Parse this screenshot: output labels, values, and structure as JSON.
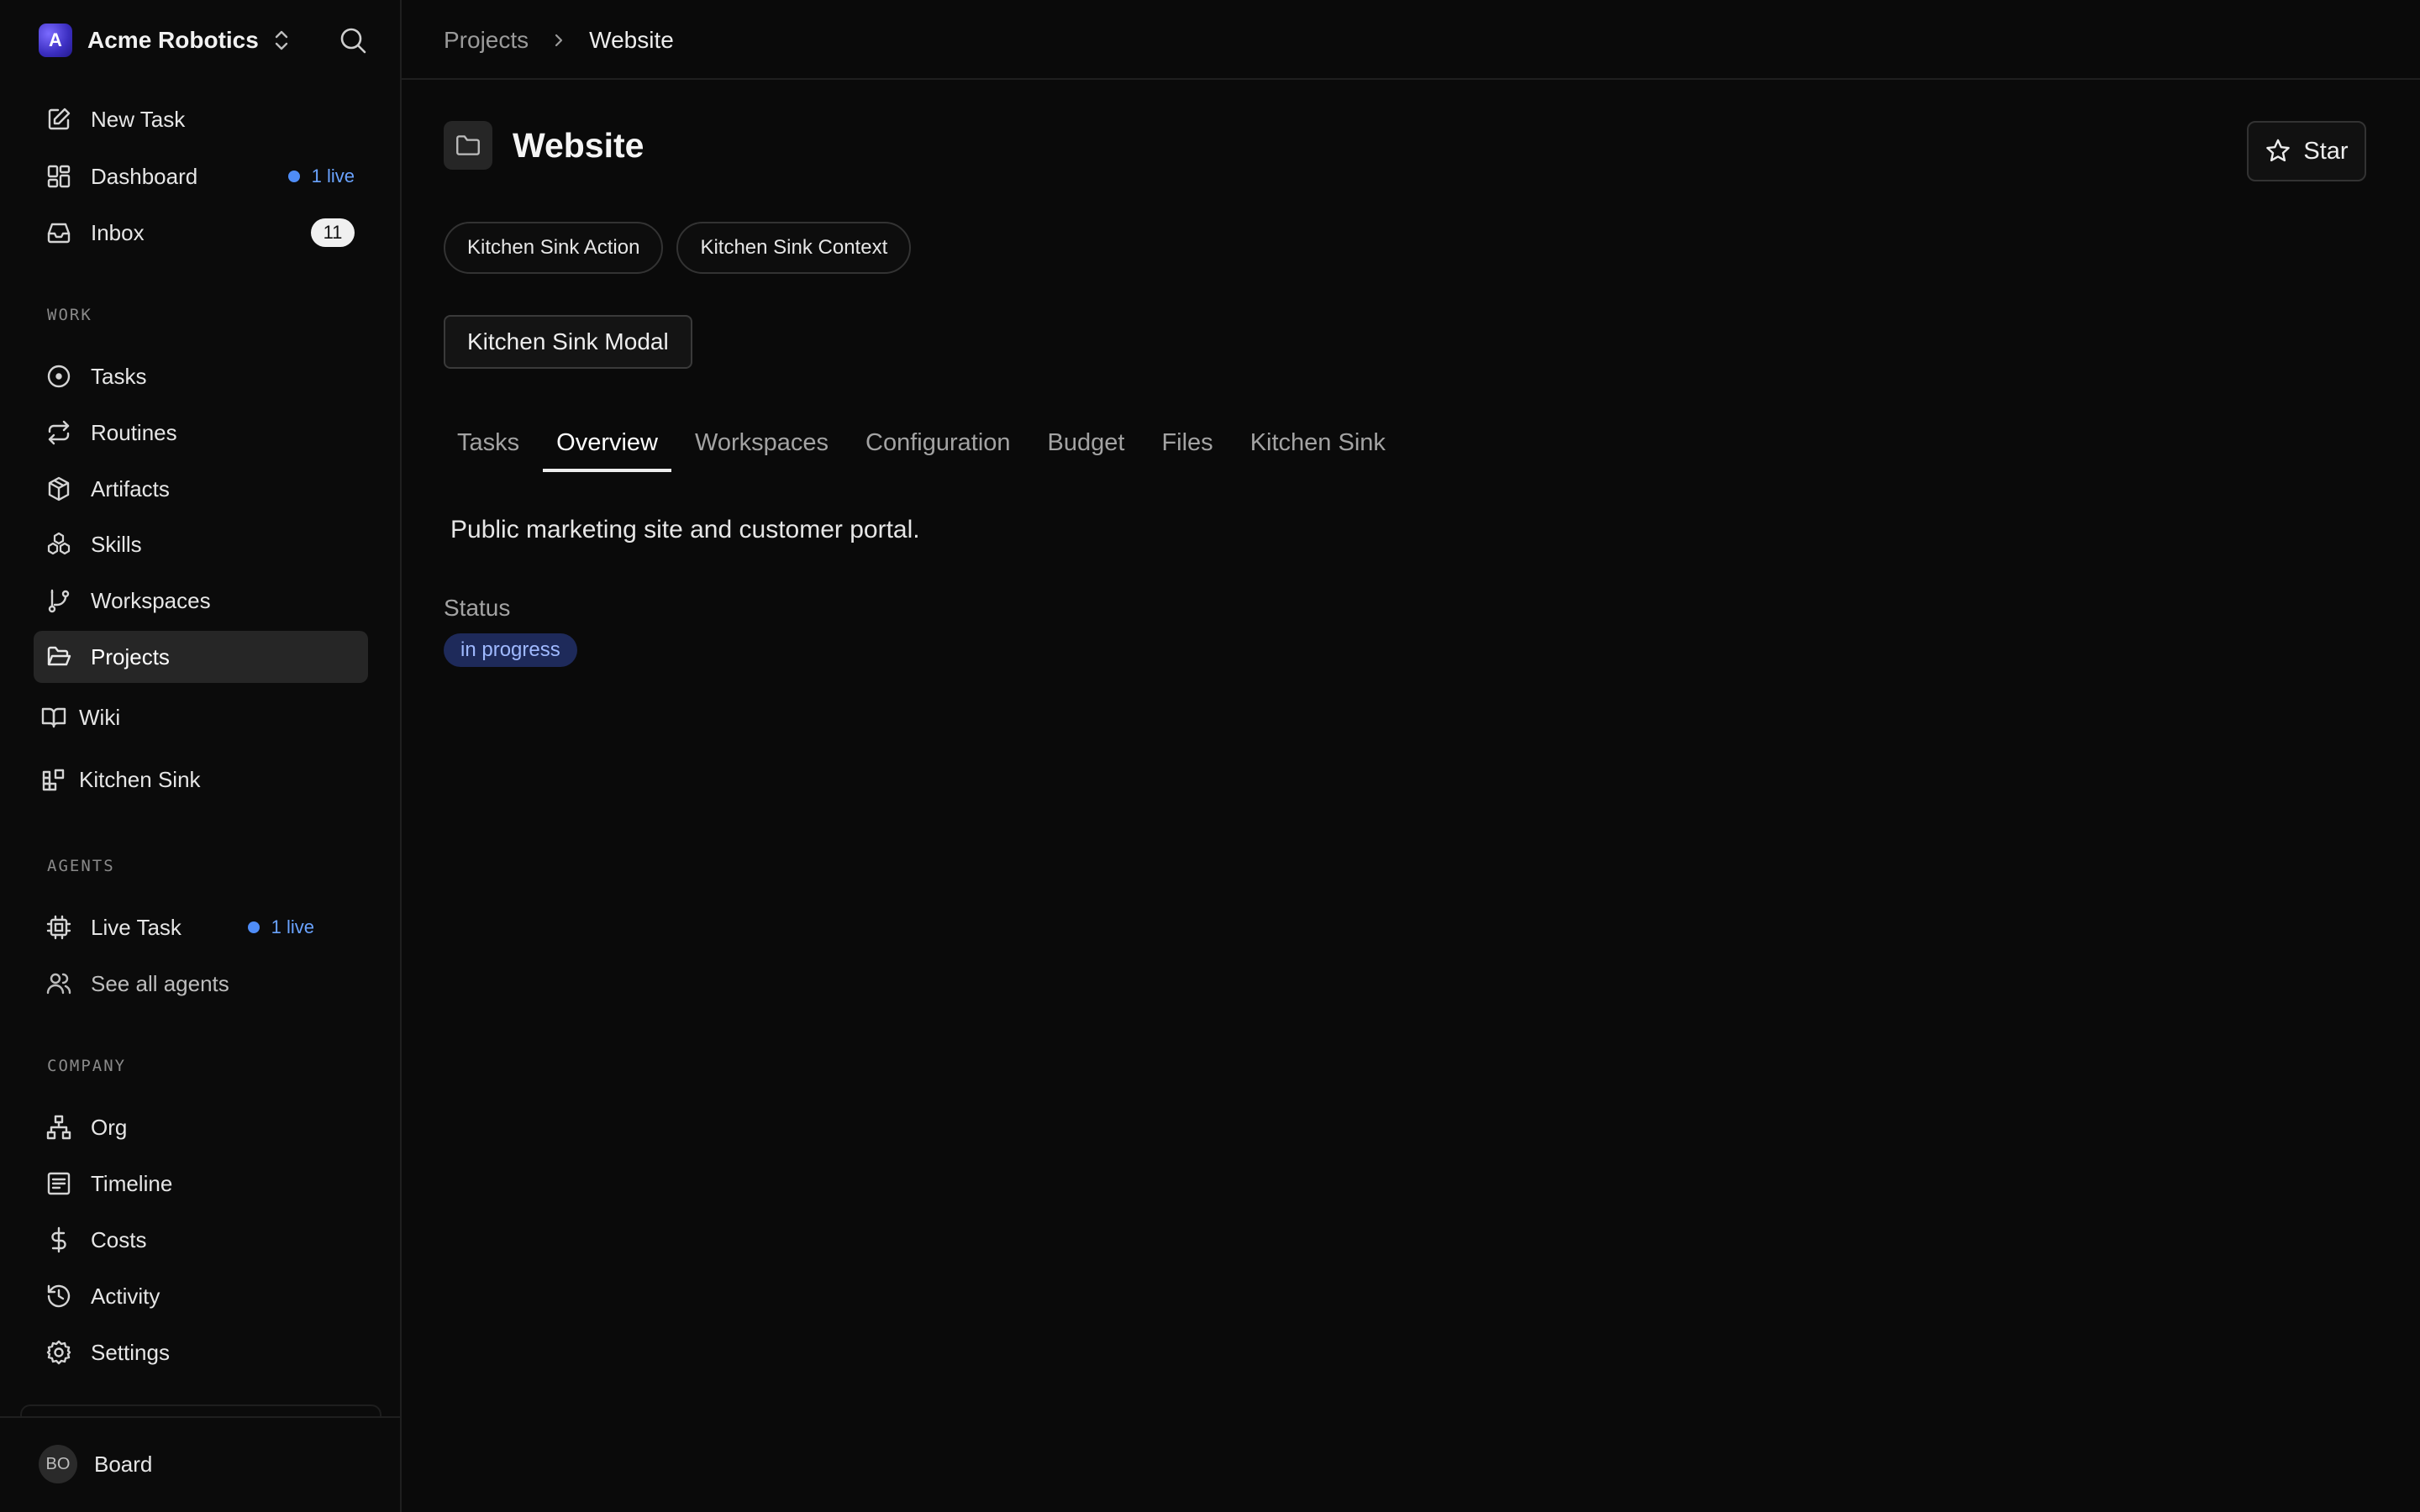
{
  "company": {
    "logo_letter": "A",
    "name": "Acme Robotics"
  },
  "sidebar": {
    "top_items": [
      {
        "label": "New Task",
        "icon": "pencil-square-icon"
      },
      {
        "label": "Dashboard",
        "icon": "dashboard-grid-icon",
        "live": "1 live"
      },
      {
        "label": "Inbox",
        "icon": "inbox-icon",
        "count": "11"
      }
    ],
    "work_label": "WORK",
    "work_items": [
      {
        "label": "Tasks",
        "icon": "circle-dot-icon"
      },
      {
        "label": "Routines",
        "icon": "repeat-icon"
      },
      {
        "label": "Artifacts",
        "icon": "package-icon"
      },
      {
        "label": "Skills",
        "icon": "boxes-icon"
      },
      {
        "label": "Workspaces",
        "icon": "git-branch-icon"
      },
      {
        "label": "Projects",
        "icon": "folder-open-icon",
        "active": true
      },
      {
        "label": "Wiki",
        "icon": "book-open-icon"
      },
      {
        "label": "Kitchen Sink",
        "icon": "blocks-icon"
      }
    ],
    "agents_label": "AGENTS",
    "agent_items": [
      {
        "label": "Live Task",
        "icon": "cpu-icon",
        "live": "1 live"
      },
      {
        "label": "See all agents",
        "icon": "users-icon"
      }
    ],
    "company_label": "COMPANY",
    "company_items": [
      {
        "label": "Org",
        "icon": "network-icon"
      },
      {
        "label": "Timeline",
        "icon": "list-document-icon"
      },
      {
        "label": "Costs",
        "icon": "dollar-sign-icon"
      },
      {
        "label": "Activity",
        "icon": "history-icon"
      },
      {
        "label": "Settings",
        "icon": "gear-icon"
      }
    ],
    "user": {
      "initials": "BO",
      "name": "Board"
    }
  },
  "breadcrumb": {
    "parent": "Projects",
    "current": "Website"
  },
  "project": {
    "title": "Website",
    "star_label": "Star",
    "actions": [
      "Kitchen Sink Action",
      "Kitchen Sink Context"
    ],
    "modal_label": "Kitchen Sink Modal",
    "tabs": [
      "Tasks",
      "Overview",
      "Workspaces",
      "Configuration",
      "Budget",
      "Files",
      "Kitchen Sink"
    ],
    "active_tab": "Overview",
    "description": "Public marketing site and customer portal.",
    "status_label": "Status",
    "status_value": "in progress"
  },
  "colors": {
    "background": "#0a0a0a",
    "accent_live": "#4f8df7",
    "status_badge_bg": "#1e2a5a",
    "status_badge_text": "#9fb9ff"
  }
}
